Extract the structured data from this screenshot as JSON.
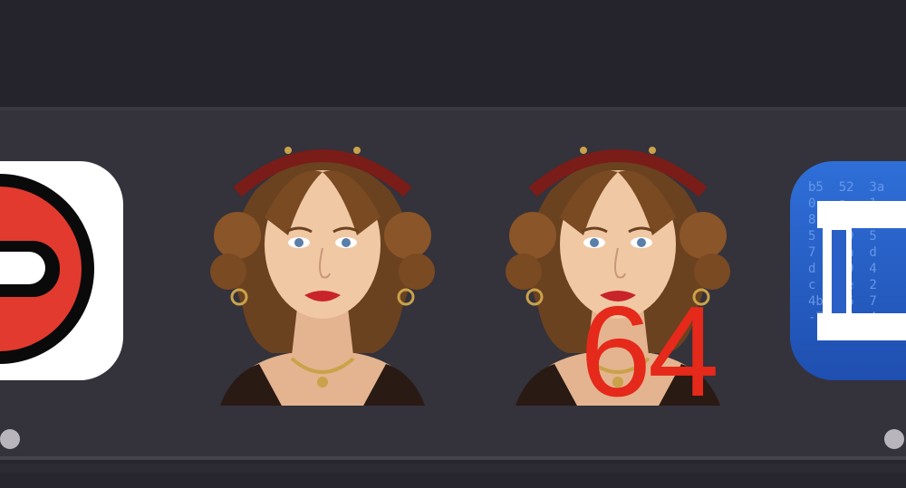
{
  "dock": {
    "apps": [
      {
        "icon": "red-mask-app-icon",
        "accent": "#e23a2e"
      },
      {
        "icon": "portrait-app-icon"
      },
      {
        "icon": "portrait-app-icon",
        "badge": "64"
      },
      {
        "icon": "blue-code-app-icon",
        "accent": "#2f6fd8"
      }
    ],
    "running_indicators": [
      true,
      false,
      false,
      true
    ]
  },
  "colors": {
    "badge": "#e5291a",
    "dock_background": "#34323b",
    "indicator": "#b8b6bc"
  },
  "blue_icon_code": "b5  52  3a\n0   a   1\n8   91  2\n5   09  5\n7   6a  d\nd   49  4\nc   5e  2\n4b  26  7\n-7  74  4"
}
